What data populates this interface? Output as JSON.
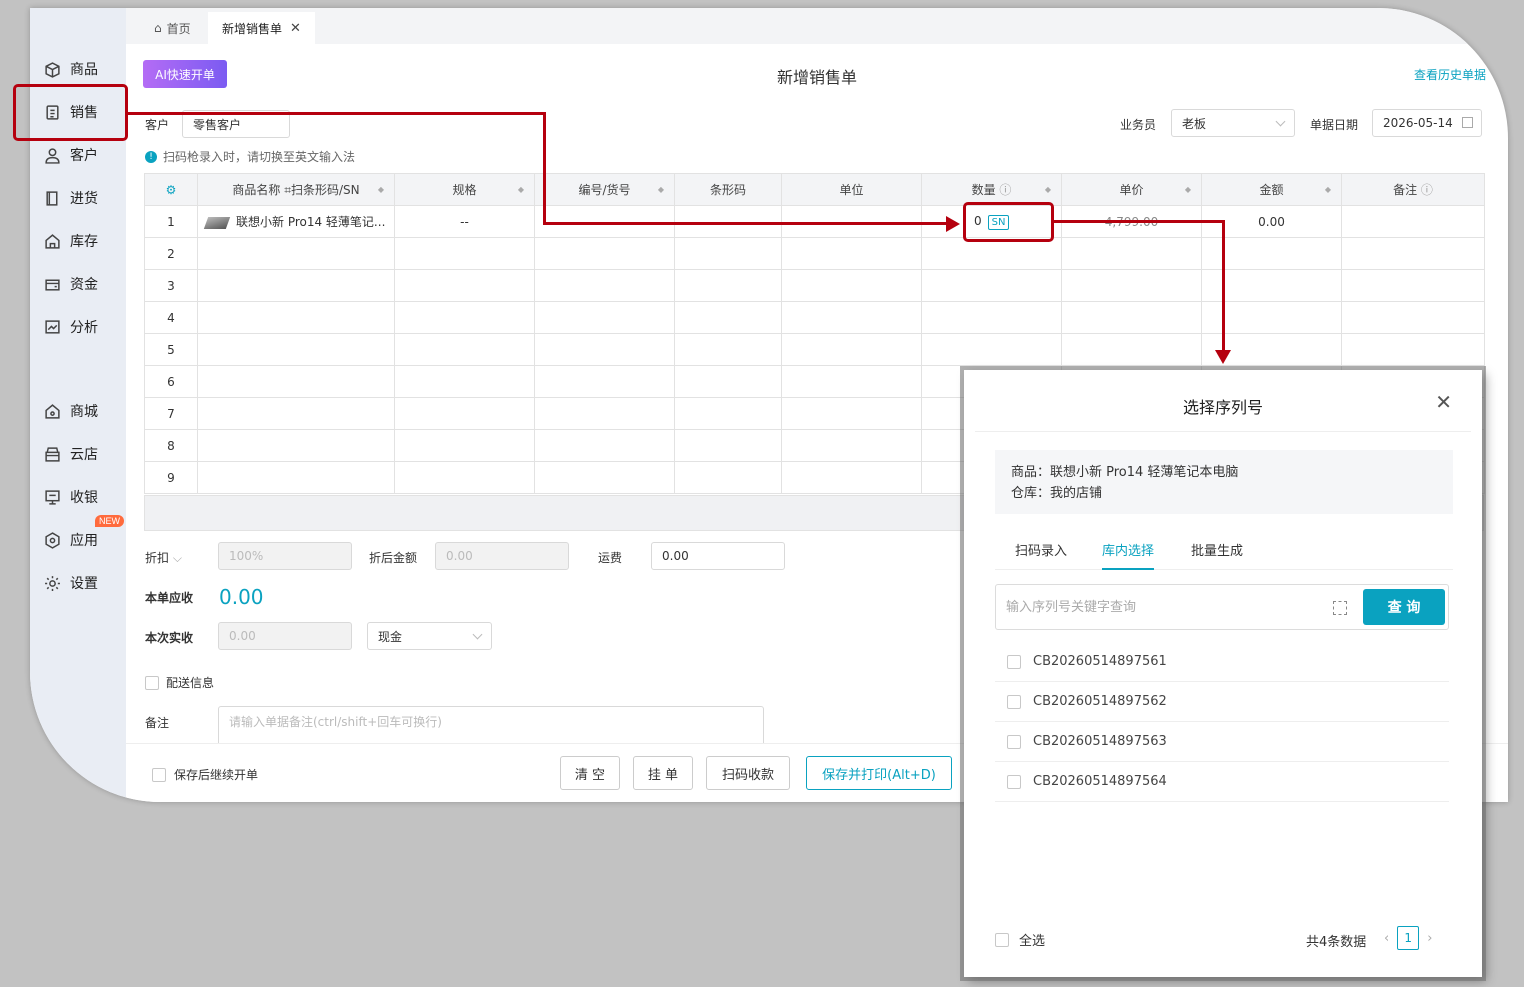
{
  "sidebar": {
    "items": [
      {
        "label": "商品",
        "icon": "box-icon"
      },
      {
        "label": "销售",
        "icon": "clipboard-icon"
      },
      {
        "label": "客户",
        "icon": "user-icon"
      },
      {
        "label": "进货",
        "icon": "book-icon"
      },
      {
        "label": "库存",
        "icon": "warehouse-icon"
      },
      {
        "label": "资金",
        "icon": "wallet-icon"
      },
      {
        "label": "分析",
        "icon": "chart-icon"
      },
      {
        "label": "商城",
        "icon": "shop-icon"
      },
      {
        "label": "云店",
        "icon": "store-icon"
      },
      {
        "label": "收银",
        "icon": "pos-icon"
      },
      {
        "label": "应用",
        "icon": "apps-icon"
      },
      {
        "label": "设置",
        "icon": "gear-icon"
      }
    ],
    "new_badge": "NEW"
  },
  "tabs": {
    "home": "首页",
    "current": "新增销售单"
  },
  "header": {
    "ai_button": "AI快速开单",
    "title": "新增销售单",
    "history_link": "查看历史单据"
  },
  "form": {
    "customer_label": "客户",
    "customer_value": "零售客户",
    "salesman_label": "业务员",
    "salesman_value": "老板",
    "date_label": "单据日期",
    "date_value": "2026-05-14",
    "scan_hint": "扫码枪录入时，请切换至英文输入法"
  },
  "table": {
    "headers": [
      "商品名称",
      "扫条形码/SN",
      "规格",
      "编号/货号",
      "条形码",
      "单位",
      "数量",
      "单价",
      "金额",
      "备注"
    ],
    "rows": [
      {
        "no": "1",
        "name": "联想小新 Pro14 轻薄笔记...",
        "spec": "--",
        "qty": "0",
        "sn": "SN",
        "price": "4,799.00",
        "amount": "0.00"
      },
      {
        "no": "2"
      },
      {
        "no": "3"
      },
      {
        "no": "4"
      },
      {
        "no": "5"
      },
      {
        "no": "6"
      },
      {
        "no": "7"
      },
      {
        "no": "8"
      },
      {
        "no": "9"
      }
    ]
  },
  "summary": {
    "discount_label": "折扣",
    "discount_value": "100%",
    "after_discount_label": "折后金额",
    "after_discount_value": "0.00",
    "freight_label": "运费",
    "freight_value": "0.00",
    "receivable_label": "本单应收",
    "receivable_value": "0.00",
    "received_label": "本次实收",
    "received_value": "0.00",
    "payment_method": "现金",
    "delivery_label": "配送信息",
    "remark_label": "备注",
    "remark_placeholder": "请输入单据备注(ctrl/shift+回车可换行)"
  },
  "actions": {
    "continue_label": "保存后继续开单",
    "clear": "清 空",
    "hold": "挂 单",
    "scan_pay": "扫码收款",
    "save_print": "保存并打印(Alt+D)"
  },
  "modal": {
    "title": "选择序列号",
    "product_line": "商品：联想小新 Pro14 轻薄笔记本电脑",
    "warehouse_line": "仓库：我的店铺",
    "tabs": [
      "扫码录入",
      "库内选择",
      "批量生成"
    ],
    "search_placeholder": "输入序列号关键字查询",
    "search_button": "查 询",
    "serials": [
      "CB20260514897561",
      "CB20260514897562",
      "CB20260514897563",
      "CB20260514897564"
    ],
    "select_all": "全选",
    "total": "共4条数据",
    "page": "1"
  },
  "colors": {
    "accent": "#0aa2c0",
    "annotation": "#b5000e",
    "ai_gradient_start": "#b46cf5"
  }
}
